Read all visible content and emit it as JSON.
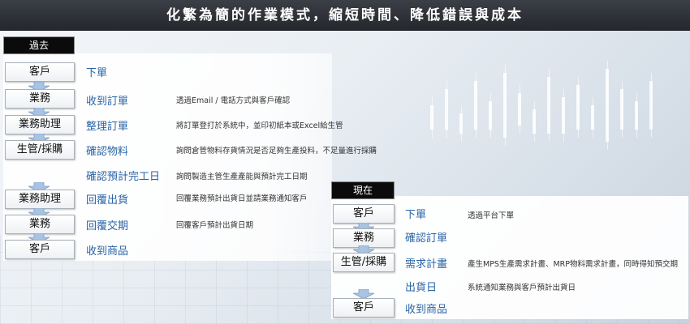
{
  "title": "化繁為簡的作業模式，縮短時間、降低錯誤與成本",
  "past": {
    "tag": "過去",
    "boxes": [
      "客戶",
      "業務",
      "業務助理",
      "生管/採購",
      "業務助理",
      "業務",
      "客戶"
    ],
    "steps": [
      "下單",
      "收到訂單",
      "整理訂單",
      "確認物料",
      "確認預計完工日",
      "回覆出貨",
      "回覆交期",
      "收到商品"
    ],
    "descs": [
      "透過Email / 電話方式與客戶確認",
      "將訂單登打於系統中，並印初紙本或Excel給生管",
      "詢問倉管物料存貨情況是否足夠生產投料，不足量進行採購",
      "詢問製造主管生產產能與預計完工日期",
      "回覆業務預計出貨日並請業務通知客戶",
      "回覆客戶預計出貨日期"
    ]
  },
  "now": {
    "tag": "現在",
    "boxes": [
      "客戶",
      "業務",
      "生管/採購",
      "客戶"
    ],
    "steps": [
      "下單",
      "確認訂單",
      "需求計畫",
      "出貨日",
      "收到商品"
    ],
    "descs": [
      "透過平台下單",
      "產生MPS生產需求計畫、MRP物料需求計畫，同時得知預交期",
      "系統通知業務與客戶預計出貨日"
    ]
  },
  "colors": {
    "step_text": "#2a64a6",
    "arrow": "#a9c3e3",
    "title_bg": "#2d3036"
  }
}
